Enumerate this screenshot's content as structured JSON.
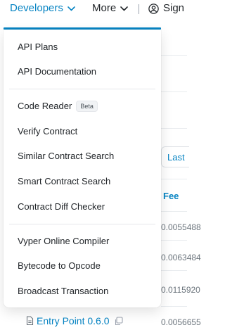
{
  "navbar": {
    "developers_label": "Developers",
    "more_label": "More",
    "signin_label": "Sign",
    "accent_color": "#0784c3"
  },
  "background": {
    "last_button_label": "Last",
    "fee_header": "Fee",
    "fee_values": [
      "0.0055488",
      "0.0063484",
      "0.0115920",
      "0.0056655"
    ],
    "bottom_link": "Entry Point 0.6.0"
  },
  "dropdown": {
    "groups": [
      [
        {
          "label": "API Plans"
        },
        {
          "label": "API Documentation"
        }
      ],
      [
        {
          "label": "Code Reader",
          "badge": "Beta"
        },
        {
          "label": "Verify Contract"
        },
        {
          "label": "Similar Contract Search"
        },
        {
          "label": "Smart Contract Search"
        },
        {
          "label": "Contract Diff Checker"
        }
      ],
      [
        {
          "label": "Vyper Online Compiler"
        },
        {
          "label": "Bytecode to Opcode"
        },
        {
          "label": "Broadcast Transaction"
        }
      ]
    ]
  }
}
